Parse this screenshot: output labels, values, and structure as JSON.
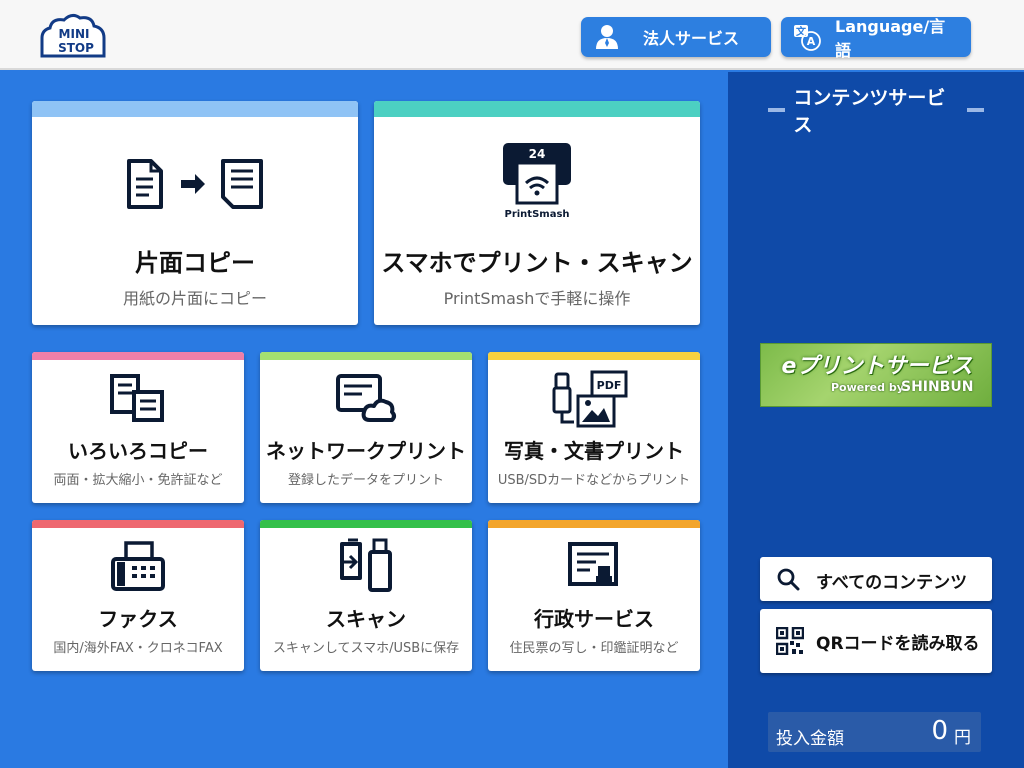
{
  "header": {
    "logo_text_top": "MINI",
    "logo_text_bottom": "STOP",
    "corporate_label": "法人サービス",
    "language_label": "Language/言語"
  },
  "cards": [
    {
      "title": "片面コピー",
      "sub": "用紙の片面にコピー",
      "bar_color": "#8fc3f5",
      "icon": "copy-arrow-icon"
    },
    {
      "title": "スマホでプリント・スキャン",
      "sub": "PrintSmashで手軽に操作",
      "bar_color": "#4cd0c2",
      "icon": "printsmash-icon",
      "icon_num": "24",
      "icon_text": "PrintSmash"
    },
    {
      "title": "いろいろコピー",
      "sub": "両面・拡大縮小・免許証など",
      "bar_color": "#f07fa8",
      "icon": "various-copy-icon"
    },
    {
      "title": "ネットワークプリント",
      "sub": "登録したデータをプリント",
      "bar_color": "#a4e070",
      "icon": "network-print-icon"
    },
    {
      "title": "写真・文書プリント",
      "sub": "USB/SDカードなどからプリント",
      "bar_color": "#f7d13f",
      "icon": "photo-document-icon",
      "icon_text": "PDF"
    },
    {
      "title": "ファクス",
      "sub": "国内/海外FAX・クロネコFAX",
      "bar_color": "#ee6870",
      "icon": "fax-icon"
    },
    {
      "title": "スキャン",
      "sub": "スキャンしてスマホ/USBに保存",
      "bar_color": "#34c04a",
      "icon": "scan-icon"
    },
    {
      "title": "行政サービス",
      "sub": "住民票の写し・印鑑証明など",
      "bar_color": "#f3a52c",
      "icon": "gov-service-icon"
    }
  ],
  "sidebar": {
    "heading": "コンテンツサービス",
    "eprint_title": "プリントサービス",
    "eprint_e": "e",
    "eprint_powered": "Powered by",
    "eprint_shinbun": "SHINBUN",
    "all_contents_label": "すべてのコンテンツ",
    "qr_label": "QRコードを読み取る",
    "coin_label": "投入金額",
    "coin_value": "0",
    "coin_unit": "円"
  },
  "colors": {
    "main_bg": "#2a7ae2",
    "sidebar_bg": "#0f4aa8",
    "button_blue": "#2d7fe0",
    "icon_navy": "#0b1a33"
  }
}
